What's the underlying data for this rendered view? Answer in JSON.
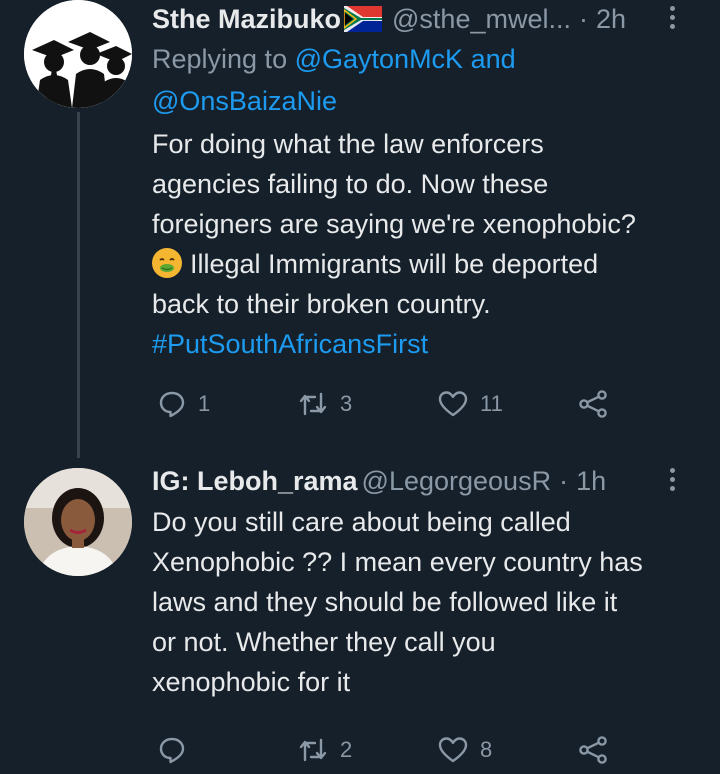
{
  "tweets": [
    {
      "name": "Sthe Mazibuko",
      "flag_icon": "south-africa-flag-icon",
      "handle": "@sthe_mwel...",
      "dot": "·",
      "time": "2h",
      "replying_prefix": "Replying to",
      "replying_to_1": "@GaytonMcK",
      "replying_and": "and",
      "replying_to_2": "@OnsBaizaNie",
      "body_line1": "For doing what the law enforcers",
      "body_line2": "agencies failing to do. Now these",
      "body_line3": "foreigners are saying we're xenophobic?",
      "emoji_icon": "nauseated-face-emoji",
      "body_line4": "Illegal Immigrants will be deported",
      "body_line5": "back to their broken country.",
      "hashtag": "#PutSouthAfricansFirst",
      "reply_count": "1",
      "retweet_count": "3",
      "like_count": "11"
    },
    {
      "name": "IG: Leboh_rama",
      "handle": "@LegorgeousR",
      "dot": "·",
      "time": "1h",
      "body_line1": "Do you still care about being called",
      "body_line2": "Xenophobic ?? I mean every country has",
      "body_line3": "laws and they should be followed like it",
      "body_line4": "or not. Whether they call you",
      "body_line5": "xenophobic for it",
      "reply_count": "",
      "retweet_count": "2",
      "like_count": "8"
    }
  ],
  "colors": {
    "background": "#15202b",
    "text": "#e7e9ea",
    "secondary": "#8b98a5",
    "link": "#1d9bf0",
    "thread_line": "#38444d"
  }
}
